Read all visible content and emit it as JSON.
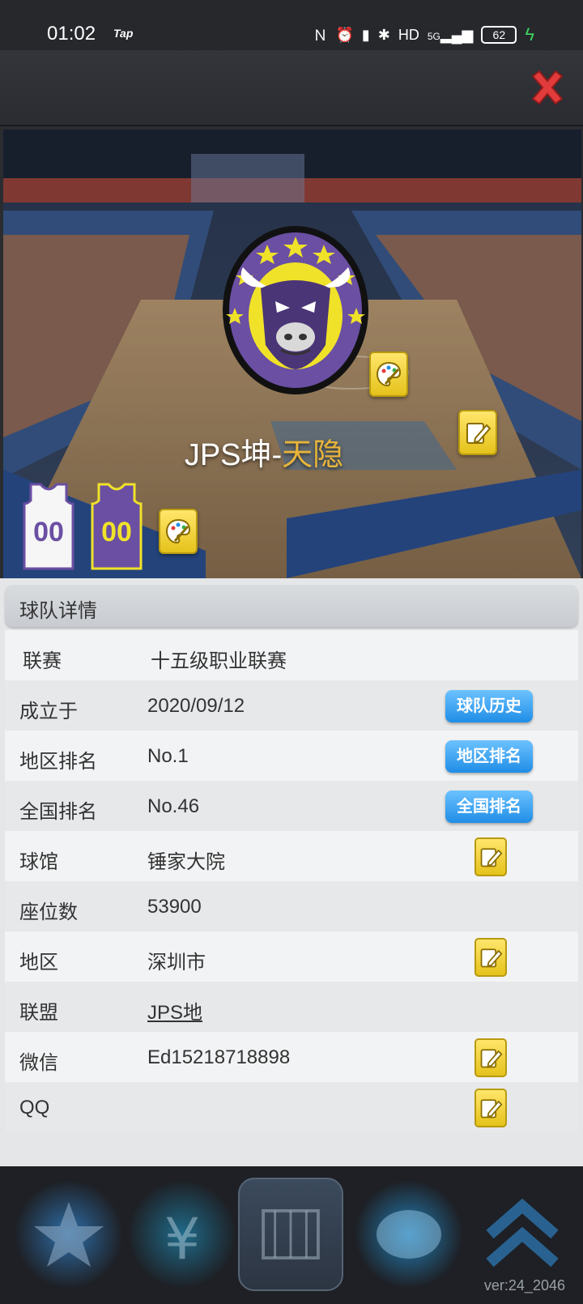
{
  "status_bar": {
    "time": "01:02",
    "app_tag": "Tap",
    "network": "5G",
    "battery": "62"
  },
  "team": {
    "name_prefix": "JPS坤-",
    "name_suffix": "天隐",
    "jersey_home_number": "00",
    "jersey_away_number": "00"
  },
  "details": {
    "section_title": "球队详情",
    "rows": [
      {
        "label": "联赛",
        "value": "十五级职业联赛"
      },
      {
        "label": "成立于",
        "value": "2020/09/12",
        "button": "球队历史"
      },
      {
        "label": "地区排名",
        "value": "No.1",
        "button": "地区排名"
      },
      {
        "label": "全国排名",
        "value": "No.46",
        "button": "全国排名"
      },
      {
        "label": "球馆",
        "value": "锤家大院"
      },
      {
        "label": "座位数",
        "value": "53900"
      },
      {
        "label": "地区",
        "value": "深圳市"
      },
      {
        "label": "联盟",
        "value": "JPS地"
      },
      {
        "label": "微信",
        "value": "Ed15218718898"
      },
      {
        "label": "QQ",
        "value": ""
      }
    ]
  },
  "version": "ver:24_2046",
  "colors": {
    "accent_blue": "#1f8de6",
    "edit_yellow": "#f5d533",
    "name_gold": "#e8b43a",
    "team_purple": "#6a4fa3",
    "close_red": "#e23b3b"
  }
}
